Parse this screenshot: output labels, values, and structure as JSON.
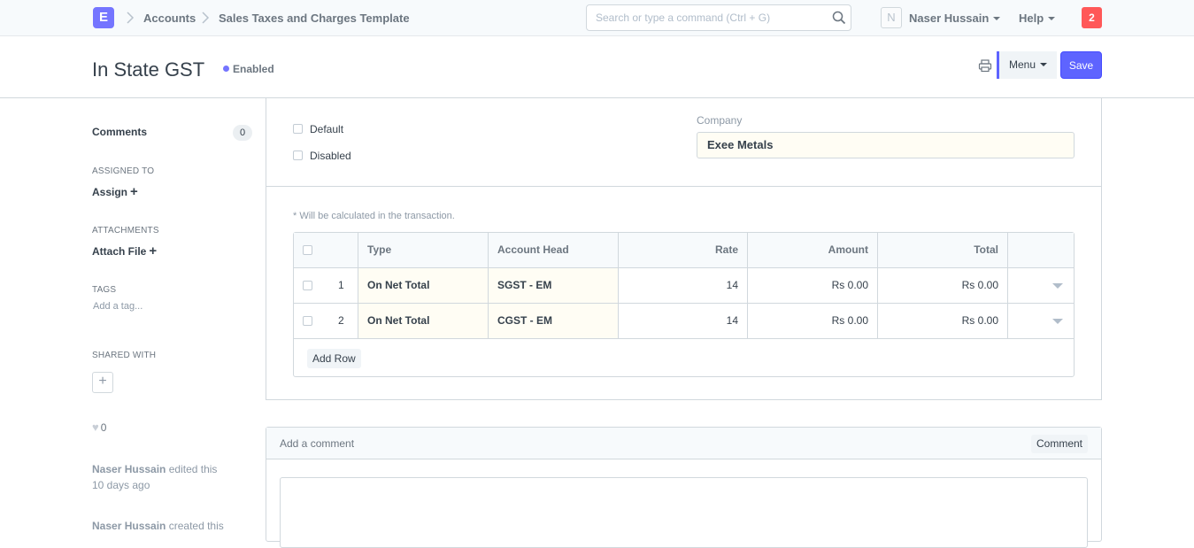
{
  "navbar": {
    "logo_letter": "E",
    "breadcrumbs": [
      "Accounts",
      "Sales Taxes and Charges Template"
    ],
    "search_placeholder": "Search or type a command (Ctrl + G)",
    "avatar_letter": "N",
    "user_name": "Naser Hussain",
    "help_label": "Help",
    "notification_count": "2",
    "accent_color": "#7575ff",
    "notification_color": "#ff5858"
  },
  "page_head": {
    "title": "In State GST",
    "status": "Enabled",
    "menu_label": "Menu",
    "save_label": "Save",
    "primary_color": "#5e64ff"
  },
  "sidebar": {
    "comments_label": "Comments",
    "comments_count": "0",
    "assigned_to_label": "ASSIGNED TO",
    "assign_label": "Assign",
    "attachments_label": "ATTACHMENTS",
    "attach_label": "Attach File",
    "tags_label": "TAGS",
    "add_tag_label": "Add a tag...",
    "shared_with_label": "SHARED WITH",
    "likes_count": "0",
    "activity": [
      {
        "user": "Naser Hussain",
        "action": "edited this",
        "time": "10 days ago"
      },
      {
        "user": "Naser Hussain",
        "action": "created this",
        "time": ""
      }
    ]
  },
  "form": {
    "default_label": "Default",
    "disabled_label": "Disabled",
    "company_label": "Company",
    "company_value": "Exee Metals",
    "calc_note": "* Will be calculated in the transaction.",
    "table": {
      "columns": [
        "Type",
        "Account Head",
        "Rate",
        "Amount",
        "Total"
      ],
      "rows": [
        {
          "idx": "1",
          "type": "On Net Total",
          "account_head": "SGST - EM",
          "rate": "14",
          "amount": "Rs 0.00",
          "total": "Rs 0.00"
        },
        {
          "idx": "2",
          "type": "On Net Total",
          "account_head": "CGST - EM",
          "rate": "14",
          "amount": "Rs 0.00",
          "total": "Rs 0.00"
        }
      ],
      "add_row_label": "Add Row"
    }
  },
  "comment_box": {
    "title": "Add a comment",
    "button_label": "Comment"
  }
}
